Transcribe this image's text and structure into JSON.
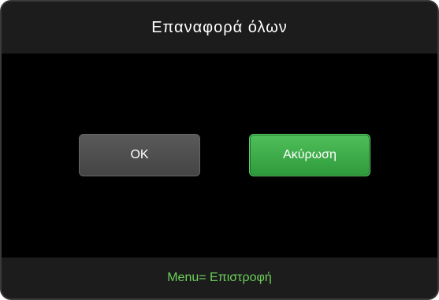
{
  "dialog": {
    "title": "Επαναφορά όλων",
    "buttons": {
      "ok_label": "OK",
      "cancel_label": "Ακύρωση"
    },
    "footer_hint": "Menu= Επιστροφή"
  },
  "colors": {
    "background": "#000000",
    "bar": "#1c1c1c",
    "ok_button": "#4f4f4f",
    "cancel_button_selected": "#3aaa46",
    "footer_text": "#6ccf5a"
  }
}
